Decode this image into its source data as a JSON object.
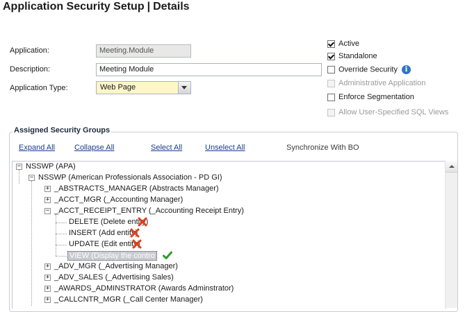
{
  "header": {
    "title_part1": "Application Security Setup",
    "separator": "|",
    "title_part2": "Details"
  },
  "form": {
    "application_label": "Application:",
    "application_value": "Meeting.Module",
    "description_label": "Description:",
    "description_value": "Meeting Module",
    "app_type_label": "Application Type:",
    "app_type_value": "Web Page"
  },
  "options": [
    {
      "label": "Active",
      "checked": true,
      "enabled": true
    },
    {
      "label": "Standalone",
      "checked": true,
      "enabled": true
    },
    {
      "label": "Override Security",
      "checked": false,
      "enabled": true
    },
    {
      "label": "Administrative Application",
      "checked": false,
      "enabled": false
    },
    {
      "label": "Enforce Segmentation",
      "checked": false,
      "enabled": true
    },
    {
      "label": "Allow User-Specified SQL Views",
      "checked": false,
      "enabled": false
    }
  ],
  "info_icon": "info-icon",
  "groups": {
    "legend": "Assigned Security Groups",
    "toolbar": {
      "expand_all": "Expand All",
      "collapse_all": "Collapse All",
      "select_all": "Select All",
      "unselect_all": "Unselect All",
      "synchronize": "Synchronize With BO"
    },
    "tree": [
      {
        "text": "NSSWP (APA)",
        "level": 0,
        "expander": "−",
        "status": ""
      },
      {
        "text": "NSSWP (American Professionals Association - PD GI)",
        "level": 1,
        "expander": "−",
        "status": ""
      },
      {
        "text": "_ABSTRACTS_MANAGER (Abstracts Manager)",
        "level": 2,
        "expander": "+",
        "status": ""
      },
      {
        "text": "_ACCT_MGR (_Accounting Manager)",
        "level": 2,
        "expander": "+",
        "status": ""
      },
      {
        "text": "_ACCT_RECEIPT_ENTRY (_Accounting Receipt Entry)",
        "level": 2,
        "expander": "−",
        "status": ""
      },
      {
        "text": "DELETE (Delete entity)",
        "level": 3,
        "expander": "",
        "status": "denied"
      },
      {
        "text": "INSERT (Add entity)",
        "level": 3,
        "expander": "",
        "status": "denied"
      },
      {
        "text": "UPDATE (Edit entity)",
        "level": 3,
        "expander": "",
        "status": "denied"
      },
      {
        "text": "VIEW (Display the contro",
        "level": 3,
        "expander": "",
        "status": "allowed",
        "selected": true
      },
      {
        "text": "_ADV_MGR (_Advertising Manager)",
        "level": 2,
        "expander": "+",
        "status": ""
      },
      {
        "text": "_ADV_SALES (_Advertising Sales)",
        "level": 2,
        "expander": "+",
        "status": ""
      },
      {
        "text": "_AWARDS_ADMINSTRATOR (Awards Adminstrator)",
        "level": 2,
        "expander": "+",
        "status": ""
      },
      {
        "text": "_CALLCNTR_MGR (_Call Center Manager)",
        "level": 2,
        "expander": "+",
        "status": ""
      }
    ]
  },
  "colors": {
    "denied": "#e0401c",
    "allowed": "#2e9a2e",
    "link": "#1a3c8c",
    "type_field_bg": "#fdf6c8"
  }
}
